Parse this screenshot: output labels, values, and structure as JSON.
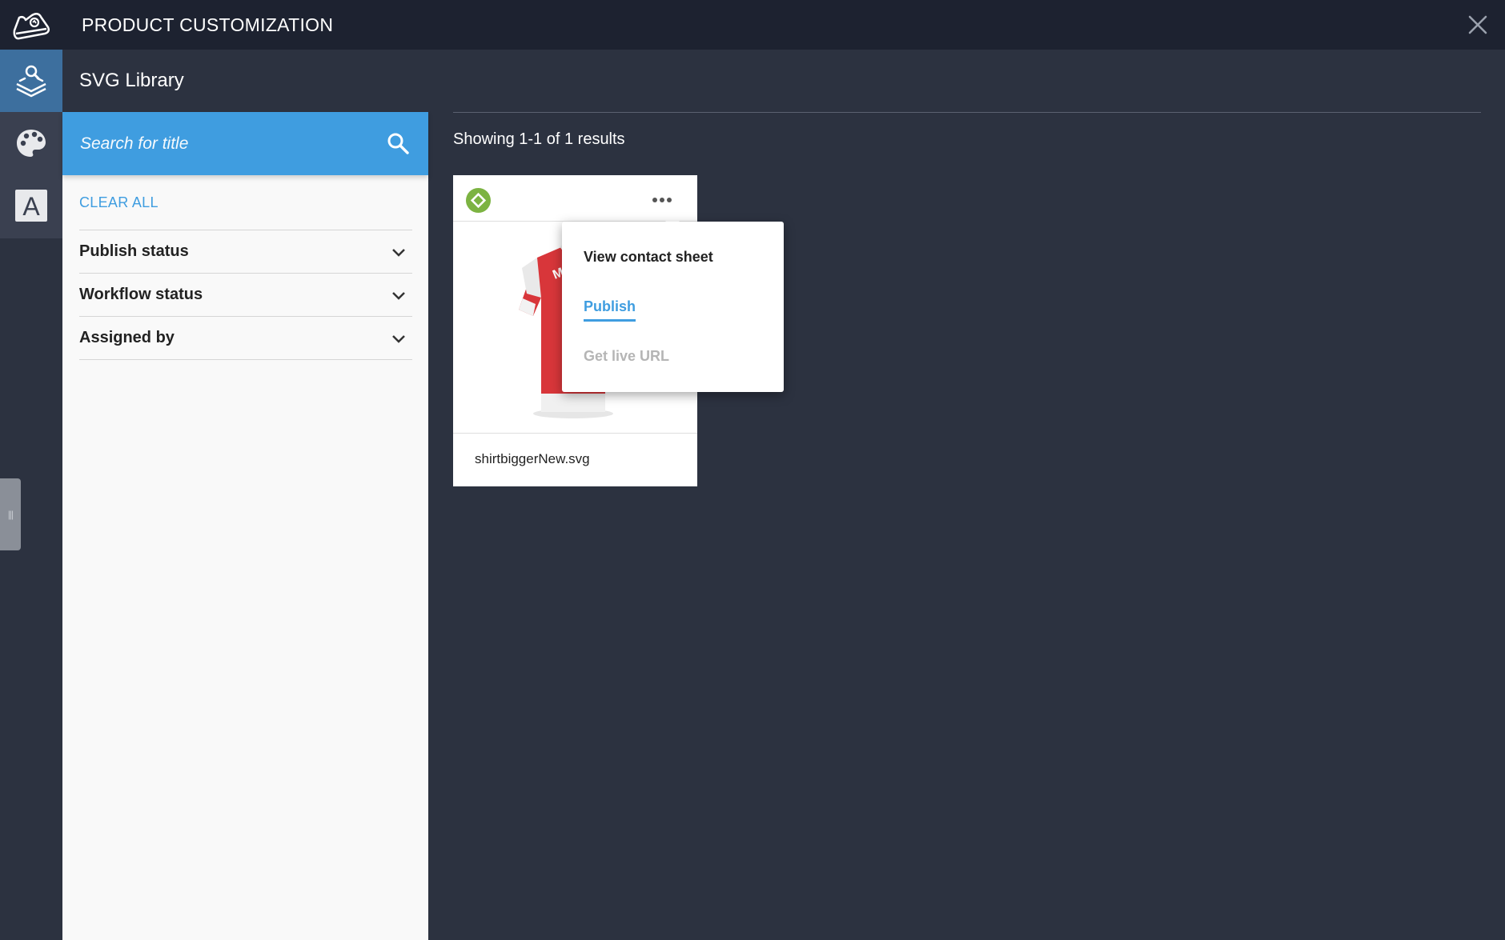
{
  "header": {
    "title": "PRODUCT CUSTOMIZATION",
    "logo_icon": "sneaker-icon",
    "close_icon": "close-icon"
  },
  "rail": {
    "items": [
      {
        "icon": "layers-search-icon",
        "active": true
      },
      {
        "icon": "palette-icon",
        "active": false
      },
      {
        "icon": "text-a-icon",
        "label": "A",
        "active": false
      }
    ],
    "handle_label": "|||"
  },
  "section": {
    "title": "SVG Library"
  },
  "search": {
    "placeholder": "Search for title",
    "value": ""
  },
  "filters": {
    "clear_all": "CLEAR ALL",
    "items": [
      {
        "label": "Publish status"
      },
      {
        "label": "Workflow status"
      },
      {
        "label": "Assigned by"
      }
    ]
  },
  "results": {
    "summary": "Showing 1-1 of 1 results",
    "cards": [
      {
        "file_name": "shirtbiggerNew.svg",
        "status_color": "#7cb342",
        "thumb_text": "MA"
      }
    ]
  },
  "menu": {
    "items": [
      {
        "label": "View contact sheet",
        "state": "normal"
      },
      {
        "label": "Publish",
        "state": "selected"
      },
      {
        "label": "Get live URL",
        "state": "disabled"
      }
    ]
  },
  "colors": {
    "accent": "#3f9de0",
    "topbar": "#1d2230",
    "background": "#2c3240",
    "rail_active": "#3d6f9e",
    "status_green": "#7cb342",
    "shirt_red": "#d8363a"
  }
}
